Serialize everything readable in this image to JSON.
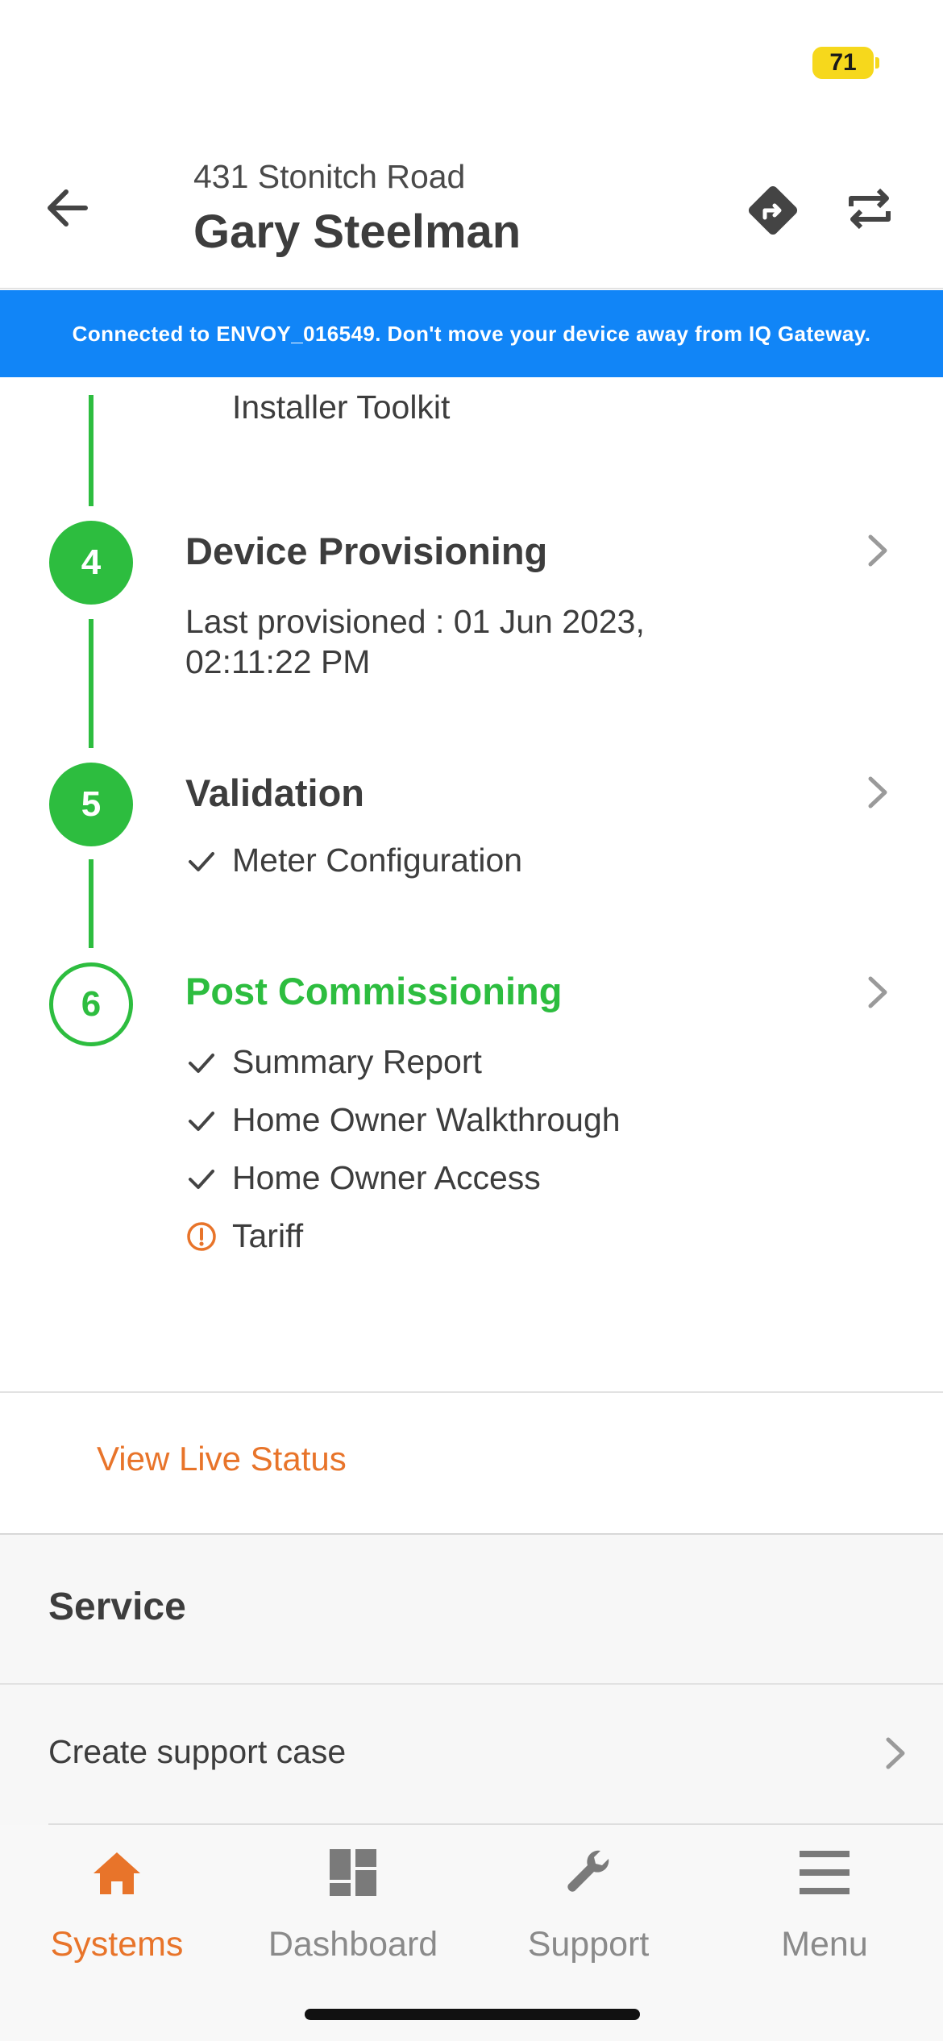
{
  "status_bar": {
    "battery": "71"
  },
  "header": {
    "address": "431 Stonitch Road",
    "name": "Gary Steelman",
    "icons": [
      "back-arrow-icon",
      "route-icon",
      "switch-icon"
    ]
  },
  "banner": {
    "text": "Connected to ENVOY_016549. Don't move your device away from IQ Gateway."
  },
  "timeline": {
    "previous_item": "Installer Toolkit",
    "steps": [
      {
        "number": "4",
        "title": "Device Provisioning",
        "desc_line1": "Last provisioned : 01 Jun 2023,",
        "desc_line2": "02:11:22 PM"
      },
      {
        "number": "5",
        "title": "Validation",
        "items": [
          {
            "label": "Meter Configuration",
            "status": "done"
          }
        ]
      },
      {
        "number": "6",
        "title": "Post Commissioning",
        "items": [
          {
            "label": "Summary Report",
            "status": "done"
          },
          {
            "label": "Home Owner Walkthrough",
            "status": "done"
          },
          {
            "label": "Home Owner Access",
            "status": "done"
          },
          {
            "label": "Tariff",
            "status": "warning"
          }
        ]
      }
    ]
  },
  "live_status": {
    "label": "View Live Status"
  },
  "service": {
    "title": "Service",
    "create_case": "Create support case"
  },
  "tabbar": {
    "tabs": [
      {
        "label": "Systems",
        "icon": "home-icon",
        "active": true
      },
      {
        "label": "Dashboard",
        "icon": "dashboard-icon",
        "active": false
      },
      {
        "label": "Support",
        "icon": "wrench-icon",
        "active": false
      },
      {
        "label": "Menu",
        "icon": "menu-icon",
        "active": false
      }
    ]
  },
  "colors": {
    "accent": "#e8742a",
    "green": "#2dbd3f",
    "banner": "#1185f7"
  }
}
